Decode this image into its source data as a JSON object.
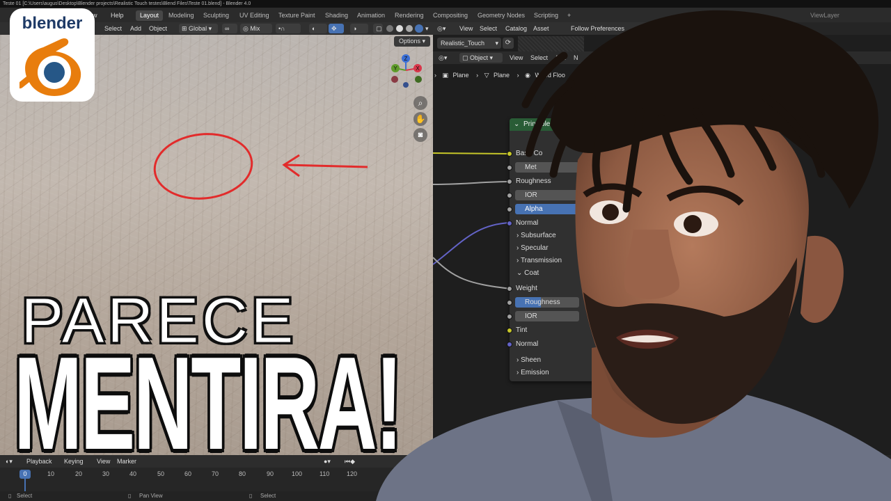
{
  "window": {
    "title": "Teste 01 [C:\\Users\\augus\\Desktop\\Blender projects\\Realistic Touch testes\\Blend Files\\Teste 01.blend] - Blender 4.0"
  },
  "menus": [
    "w",
    "Help"
  ],
  "workspace_tabs": [
    "Layout",
    "Modeling",
    "Sculpting",
    "UV Editing",
    "Texture Paint",
    "Shading",
    "Animation",
    "Rendering",
    "Compositing",
    "Geometry Nodes",
    "Scripting",
    "+"
  ],
  "active_tab": "Layout",
  "viewlayer": "ViewLayer",
  "viewport": {
    "header_items": [
      "Select",
      "Add",
      "Object"
    ],
    "orientation": "Global",
    "shading_mode": "Mix",
    "options_label": "Options",
    "gizmo_axes": {
      "z": "Z",
      "y": "Y",
      "x": "X"
    }
  },
  "node_editor": {
    "header_items": [
      "View",
      "Select",
      "Catalog",
      "Asset"
    ],
    "follow_prefs": "Follow Preferences",
    "library": "Realistic_Touch",
    "object_mode": "Object",
    "sub_menu": [
      "View",
      "Select",
      "Add",
      "N"
    ],
    "breadcrumb": [
      "Plane",
      "Plane",
      "Wood Floo"
    ],
    "node": {
      "title": "Principled B",
      "rows": [
        {
          "label": "Base Co",
          "type": "socket",
          "color": "#c7c729"
        },
        {
          "label": "Met",
          "type": "field"
        },
        {
          "label": "Roughness",
          "type": "socket",
          "color": "#a1a1a1"
        },
        {
          "label": "IOR",
          "type": "field"
        },
        {
          "label": "Alpha",
          "type": "field-blue"
        },
        {
          "label": "Normal",
          "type": "socket",
          "color": "#6363c7"
        },
        {
          "label": "Subsurface",
          "type": "panel"
        },
        {
          "label": "Specular",
          "type": "panel"
        },
        {
          "label": "Transmission",
          "type": "panel"
        },
        {
          "label": "Coat",
          "type": "panel-open"
        },
        {
          "label": "Weight",
          "type": "socket",
          "color": "#a1a1a1"
        },
        {
          "label": "Roughness",
          "type": "field-part"
        },
        {
          "label": "IOR",
          "type": "field"
        },
        {
          "label": "Tint",
          "type": "socket",
          "color": "#c7c729"
        },
        {
          "label": "Normal",
          "type": "socket",
          "color": "#6363c7"
        },
        {
          "label": "Sheen",
          "type": "panel"
        },
        {
          "label": "Emission",
          "type": "panel"
        }
      ]
    }
  },
  "timeline": {
    "menu": [
      "Playback",
      "Keying",
      "View",
      "Marker"
    ],
    "current_frame": "0",
    "ticks": [
      "10",
      "20",
      "30",
      "40",
      "50",
      "60",
      "70",
      "80",
      "90",
      "100",
      "110",
      "120"
    ]
  },
  "statusbar": {
    "items": [
      "Select",
      "Pan View",
      "Select"
    ]
  },
  "logo": {
    "text": "blender"
  },
  "thumbnail": {
    "line1": "PARECE",
    "line2": "MENTIRA!"
  },
  "colors": {
    "annotation_red": "#e22b2b",
    "node_header": "#295c36",
    "accent_blue": "#4772b3"
  }
}
